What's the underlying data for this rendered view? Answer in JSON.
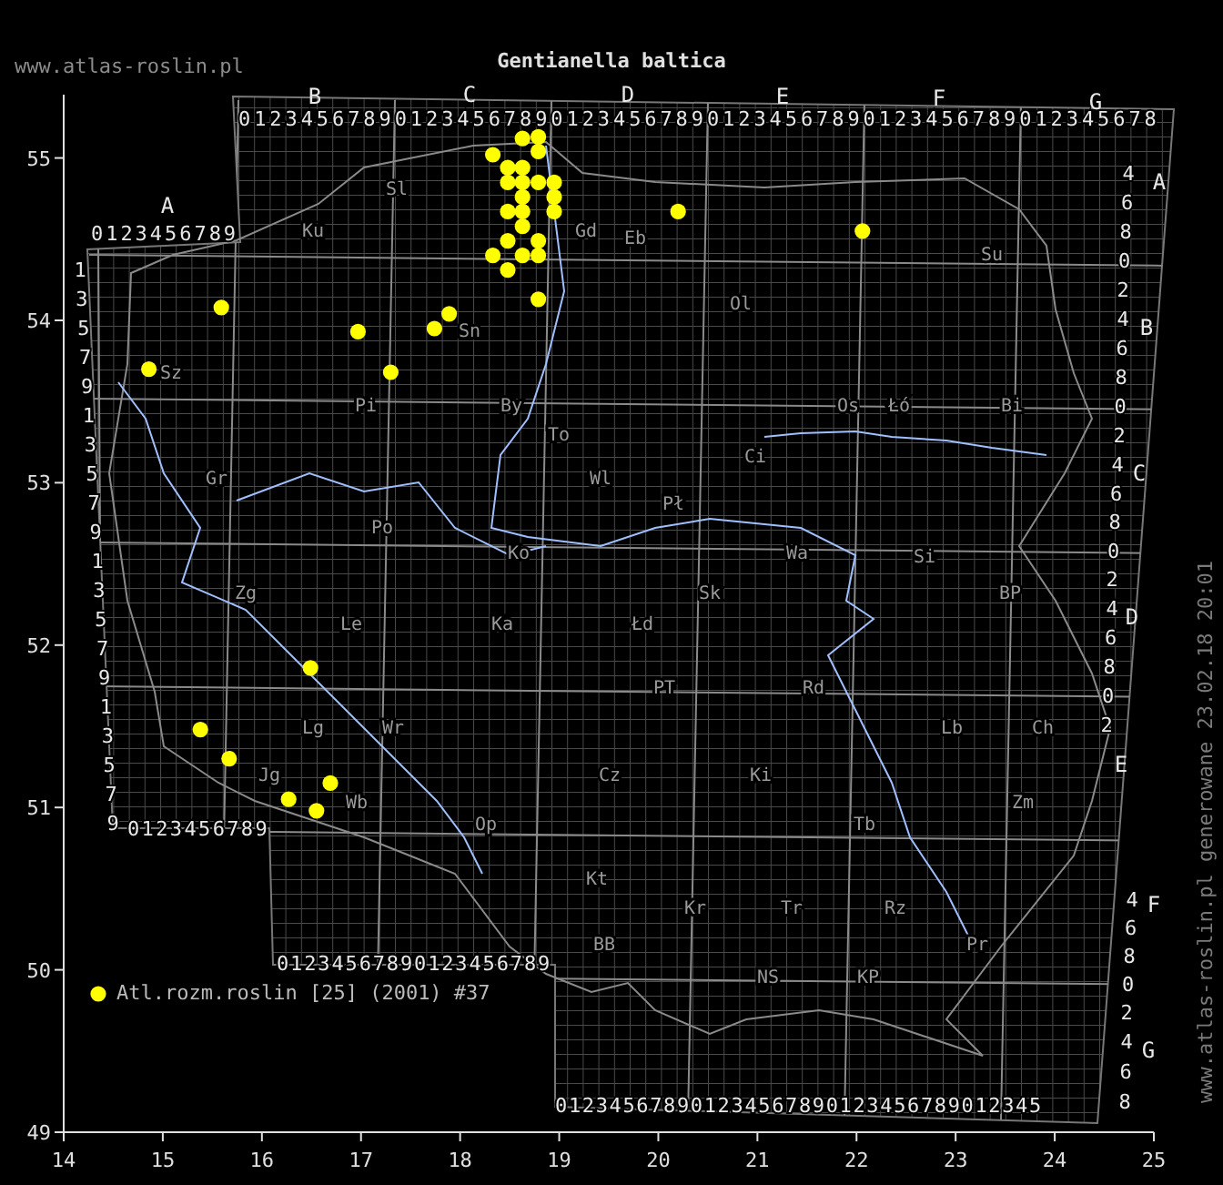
{
  "header": {
    "site": "www.atlas-roslin.pl",
    "title": "Gentianella baltica"
  },
  "map": {
    "chart_data": {
      "type": "scatter",
      "xlim": [
        14,
        25
      ],
      "ylim": [
        49,
        55.39
      ],
      "xticks": [
        14,
        15,
        16,
        17,
        18,
        19,
        20,
        21,
        22,
        23,
        24,
        25
      ],
      "yticks": [
        49,
        50,
        51,
        52,
        53,
        54,
        55
      ],
      "x": [
        18.63,
        18.79,
        18.33,
        18.79,
        18.48,
        18.63,
        18.48,
        18.63,
        18.79,
        18.95,
        18.63,
        18.95,
        18.48,
        18.63,
        18.95,
        18.63,
        18.48,
        18.79,
        18.33,
        18.63,
        18.79,
        18.48,
        18.79,
        15.59,
        16.97,
        17.74,
        17.89,
        17.3,
        14.86,
        20.2,
        22.06,
        16.49,
        15.38,
        15.67,
        16.69,
        16.27,
        16.55
      ],
      "series": [
        {
          "name": "Atl.rozm.roslin [25] (2001) #37",
          "color": "#ffff00",
          "values": [
            55.12,
            55.13,
            55.02,
            55.04,
            54.94,
            54.94,
            54.85,
            54.85,
            54.85,
            54.85,
            54.76,
            54.76,
            54.67,
            54.67,
            54.67,
            54.58,
            54.49,
            54.49,
            54.4,
            54.4,
            54.4,
            54.31,
            54.13,
            54.08,
            53.93,
            53.95,
            54.04,
            53.68,
            53.7,
            54.67,
            54.55,
            51.86,
            51.48,
            51.3,
            51.15,
            51.05,
            50.98
          ]
        }
      ]
    },
    "grid_column_letters": [
      "A",
      "B",
      "C",
      "D",
      "E",
      "F",
      "G"
    ],
    "grid_row_letters": [
      "A",
      "B",
      "C",
      "D",
      "E",
      "F",
      "G"
    ],
    "grid_column_digits": [
      "0123456789",
      "01234567890123456789012345678901234567890123456789012345678",
      "0123456789",
      "01234567890123456789",
      "012345678901234567890123456789012345"
    ],
    "grid_row_digits": [
      "13579135791357913579",
      "46802",
      "46802",
      "46802",
      "46802",
      "46802",
      "468"
    ],
    "region_labels": [
      "Sl",
      "Ku",
      "Gd",
      "Eb",
      "Su",
      "Ol",
      "Sn",
      "Sz",
      "Pi",
      "By",
      "Os",
      "Łó",
      "Bi",
      "To",
      "Ci",
      "Gr",
      "Wl",
      "Pł",
      "Po",
      "Ko",
      "Wa",
      "Si",
      "Zg",
      "Sk",
      "BP",
      "Le",
      "Ka",
      "Łd",
      "PT",
      "Rd",
      "Lg",
      "Wr",
      "Lb",
      "Ch",
      "Jg",
      "Cz",
      "Ki",
      "Wb",
      "Zm",
      "Op",
      "Tb",
      "Kt",
      "Kr",
      "Tr",
      "Rz",
      "BB",
      "Pr",
      "NS",
      "KP"
    ]
  },
  "footer_note": "www.atlas-roslin.pl generowane 23.02.18 20:01"
}
